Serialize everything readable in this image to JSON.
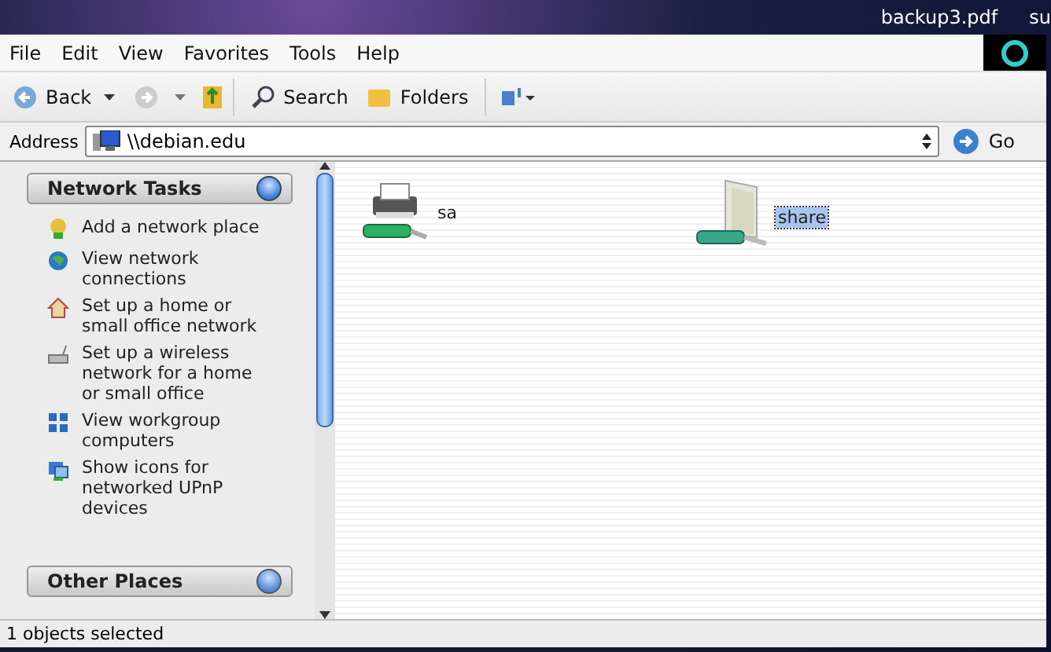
{
  "desktop": {
    "files": [
      {
        "label": "backup3.pdf"
      },
      {
        "label": "su"
      }
    ]
  },
  "menu": [
    "File",
    "Edit",
    "View",
    "Favorites",
    "Tools",
    "Help"
  ],
  "toolbar": {
    "back": "Back",
    "search": "Search",
    "folders": "Folders"
  },
  "address": {
    "label": "Address",
    "value": "\\\\debian.edu",
    "go": "Go"
  },
  "sidebar": {
    "panels": [
      {
        "title": "Network Tasks",
        "expanded": true,
        "items": [
          "Add a network place",
          "View network connections",
          "Set up a home or small office network",
          "Set up a wireless network for a home or small office",
          "View workgroup computers",
          "Show icons for networked UPnP devices"
        ]
      },
      {
        "title": "Other Places",
        "expanded": false
      }
    ]
  },
  "items": [
    {
      "label": "sa",
      "kind": "printer",
      "selected": false
    },
    {
      "label": "share",
      "kind": "folder",
      "selected": true
    }
  ],
  "status_bar": "1 objects selected"
}
